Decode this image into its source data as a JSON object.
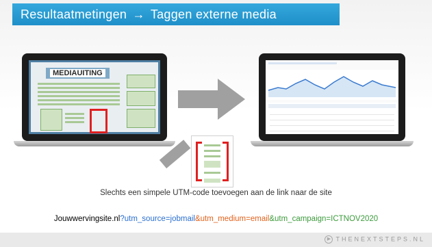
{
  "slide": {
    "title_part1": "Resultaatmetingen",
    "title_arrow": "→",
    "title_part2": "Taggen externe media",
    "mockup_label": "MEDIAUITING",
    "caption": "Slechts een simpele UTM-code toevoegen aan de link naar de site",
    "url": {
      "base": "Jouwwervingsite.nl",
      "p1": "?utm_source=jobmail",
      "p2": "&utm_medium=email",
      "p3": "&utm_campaign=ICTNOV2020"
    },
    "brand": "THENEXTSTEPS.NL"
  },
  "colors": {
    "title_bar": "#2b9cd8",
    "url_blue": "#2a6fcf",
    "url_orange": "#e0621b",
    "url_green": "#3c9a3c",
    "bracket_red": "#e02020"
  }
}
